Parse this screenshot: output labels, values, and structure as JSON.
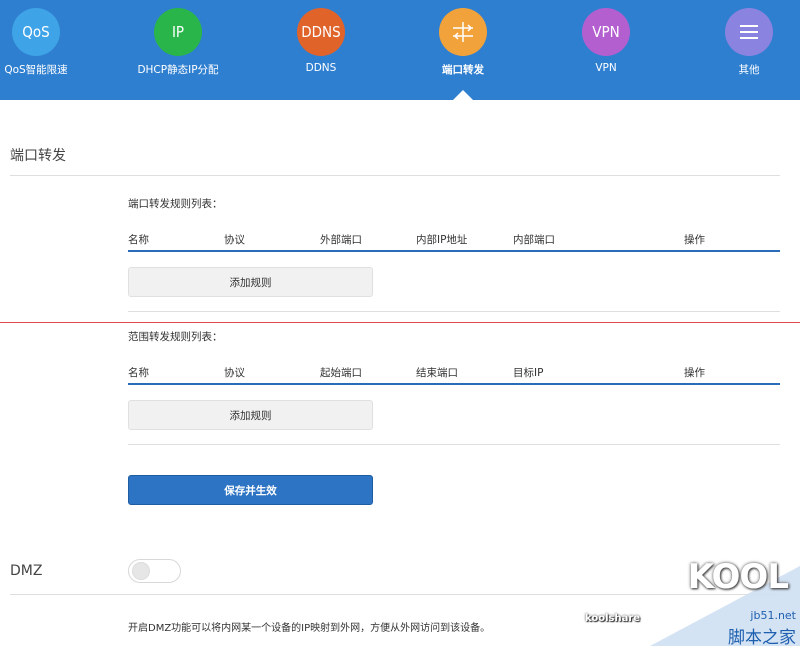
{
  "nav": {
    "items": [
      {
        "icon_text": "QoS",
        "label": "QoS智能限速",
        "color": "#3fa3e8",
        "icon": "qos-icon"
      },
      {
        "icon_text": "IP",
        "label": "DHCP静态IP分配",
        "color": "#2ab54a",
        "icon": "ip-icon"
      },
      {
        "icon_text": "DDNS",
        "label": "DDNS",
        "color": "#e0632a",
        "icon": "ddns-icon"
      },
      {
        "icon_text": "",
        "label": "端口转发",
        "color": "#f2a23a",
        "icon": "port-forward-icon",
        "active": true
      },
      {
        "icon_text": "VPN",
        "label": "VPN",
        "color": "#b45fd0",
        "icon": "vpn-icon"
      },
      {
        "icon_text": "",
        "label": "其他",
        "color": "#8a83e0",
        "icon": "menu-icon"
      }
    ],
    "background": "#2f7fd0"
  },
  "page": {
    "title": "端口转发"
  },
  "port_rules": {
    "title": "端口转发规则列表：",
    "columns": [
      "名称",
      "协议",
      "外部端口",
      "内部IP地址",
      "内部端口",
      "操作"
    ],
    "add_label": "添加规则"
  },
  "range_rules": {
    "title": "范围转发规则列表：",
    "columns": [
      "名称",
      "协议",
      "起始端口",
      "结束端口",
      "目标IP",
      "操作"
    ],
    "add_label": "添加规则"
  },
  "save_label": "保存并生效",
  "dmz": {
    "label": "DMZ",
    "enabled": false,
    "description": "开启DMZ功能可以将内网某一个设备的IP映射到外网，方便从外网访问到该设备。"
  },
  "watermark": {
    "logo": "KOOL",
    "brand": "koolshare",
    "site": "jb51.net",
    "site_cn": "脚本之家"
  }
}
